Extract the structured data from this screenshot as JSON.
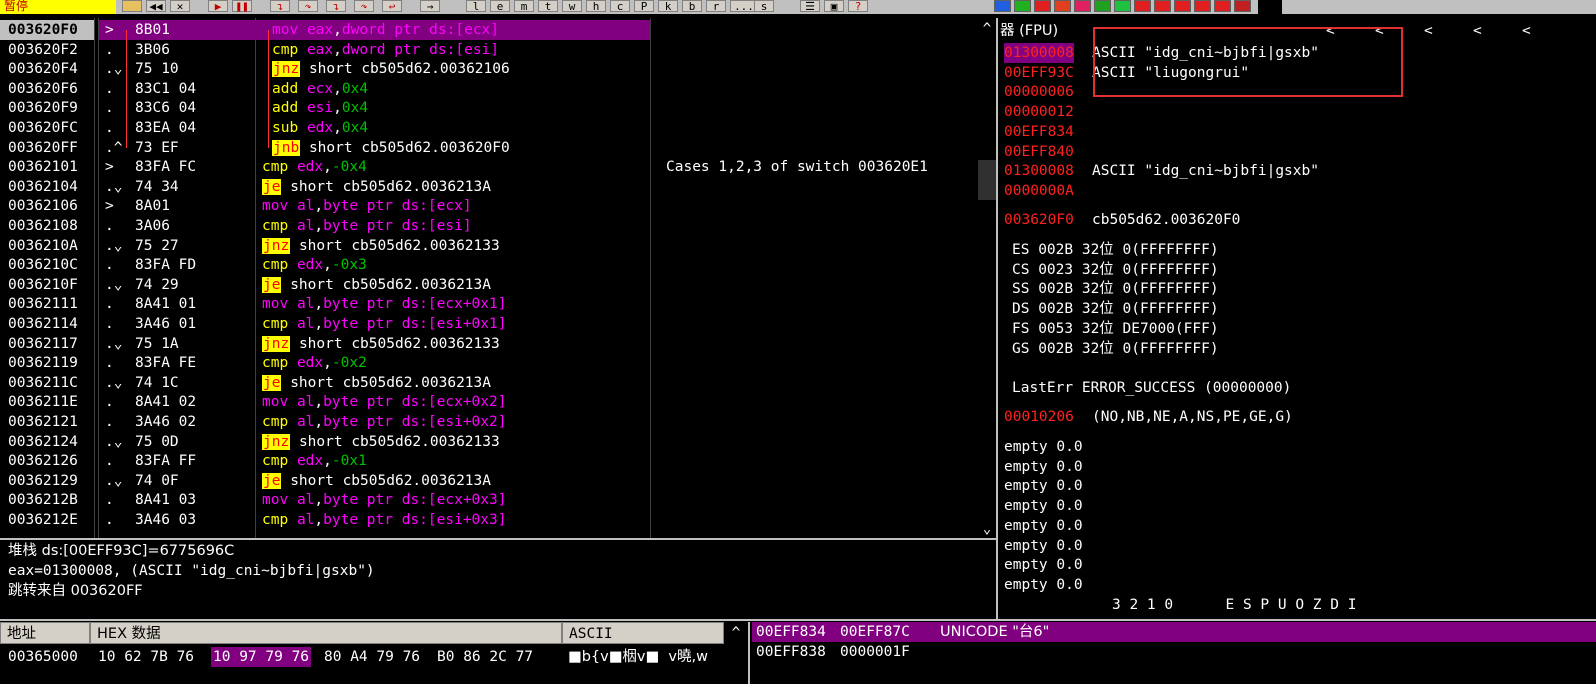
{
  "toolbar": {
    "status_label": "暂停",
    "letter_buttons": [
      "l",
      "e",
      "m",
      "t",
      "w",
      "h",
      "c",
      "P",
      "k",
      "b",
      "r",
      "...",
      "s"
    ],
    "colors": {
      "bg": "#c0c0c0",
      "status_bg": "#ffff00",
      "status_fg": "#c00000"
    }
  },
  "disasm": {
    "rows": [
      {
        "addr": "003620F0",
        "mark": ">",
        "hex": "8B01",
        "op": "mov",
        "args": [
          [
            "eax",
            "r"
          ],
          [
            ",",
            "p"
          ],
          [
            "dword ptr ds:[ecx]",
            "m"
          ]
        ],
        "selected": true,
        "comment": ""
      },
      {
        "addr": "003620F2",
        "mark": ".",
        "hex": "3B06",
        "op": "cmp",
        "args": [
          [
            "eax",
            "r"
          ],
          [
            ",",
            "p"
          ],
          [
            "dword ptr ds:[esi]",
            "m"
          ]
        ],
        "comment": ""
      },
      {
        "addr": "003620F4",
        "mark": ".⌄",
        "hex": "75 10",
        "op": "jnz",
        "args": [
          [
            "short cb505d62.00362106",
            "p"
          ]
        ],
        "comment": ""
      },
      {
        "addr": "003620F6",
        "mark": ".",
        "hex": "83C1 04",
        "op": "add",
        "args": [
          [
            "ecx",
            "r"
          ],
          [
            ",",
            "p"
          ],
          [
            "0x4",
            "n"
          ]
        ],
        "comment": ""
      },
      {
        "addr": "003620F9",
        "mark": ".",
        "hex": "83C6 04",
        "op": "add",
        "args": [
          [
            "esi",
            "r"
          ],
          [
            ",",
            "p"
          ],
          [
            "0x4",
            "n"
          ]
        ],
        "comment": ""
      },
      {
        "addr": "003620FC",
        "mark": ".",
        "hex": "83EA 04",
        "op": "sub",
        "args": [
          [
            "edx",
            "r"
          ],
          [
            ",",
            "p"
          ],
          [
            "0x4",
            "n"
          ]
        ],
        "comment": ""
      },
      {
        "addr": "003620FF",
        "mark": ".^",
        "hex": "73 EF",
        "op": "jnb",
        "args": [
          [
            "short cb505d62.003620F0",
            "p"
          ]
        ],
        "comment": ""
      },
      {
        "addr": "00362101",
        "mark": ">",
        "hex": "83FA FC",
        "op": "cmp",
        "args": [
          [
            "edx",
            "r"
          ],
          [
            ",",
            "p"
          ],
          [
            "-0x4",
            "n"
          ]
        ],
        "comment": "Cases 1,2,3 of switch 003620E1"
      },
      {
        "addr": "00362104",
        "mark": ".⌄",
        "hex": "74 34",
        "op": "je",
        "args": [
          [
            "short cb505d62.0036213A",
            "p"
          ]
        ],
        "comment": ""
      },
      {
        "addr": "00362106",
        "mark": ">",
        "hex": "8A01",
        "op": "mov",
        "args": [
          [
            "al",
            "r"
          ],
          [
            ",",
            "p"
          ],
          [
            "byte ptr ds:[ecx]",
            "m"
          ]
        ],
        "comment": ""
      },
      {
        "addr": "00362108",
        "mark": ".",
        "hex": "3A06",
        "op": "cmp",
        "args": [
          [
            "al",
            "r"
          ],
          [
            ",",
            "p"
          ],
          [
            "byte ptr ds:[esi]",
            "m"
          ]
        ],
        "comment": ""
      },
      {
        "addr": "0036210A",
        "mark": ".⌄",
        "hex": "75 27",
        "op": "jnz",
        "args": [
          [
            "short cb505d62.00362133",
            "p"
          ]
        ],
        "comment": ""
      },
      {
        "addr": "0036210C",
        "mark": ".",
        "hex": "83FA FD",
        "op": "cmp",
        "args": [
          [
            "edx",
            "r"
          ],
          [
            ",",
            "p"
          ],
          [
            "-0x3",
            "n"
          ]
        ],
        "comment": ""
      },
      {
        "addr": "0036210F",
        "mark": ".⌄",
        "hex": "74 29",
        "op": "je",
        "args": [
          [
            "short cb505d62.0036213A",
            "p"
          ]
        ],
        "comment": ""
      },
      {
        "addr": "00362111",
        "mark": ".",
        "hex": "8A41 01",
        "op": "mov",
        "args": [
          [
            "al",
            "r"
          ],
          [
            ",",
            "p"
          ],
          [
            "byte ptr ds:[ecx+0x1]",
            "m"
          ]
        ],
        "comment": ""
      },
      {
        "addr": "00362114",
        "mark": ".",
        "hex": "3A46 01",
        "op": "cmp",
        "args": [
          [
            "al",
            "r"
          ],
          [
            ",",
            "p"
          ],
          [
            "byte ptr ds:[esi+0x1]",
            "m"
          ]
        ],
        "comment": ""
      },
      {
        "addr": "00362117",
        "mark": ".⌄",
        "hex": "75 1A",
        "op": "jnz",
        "args": [
          [
            "short cb505d62.00362133",
            "p"
          ]
        ],
        "comment": ""
      },
      {
        "addr": "00362119",
        "mark": ".",
        "hex": "83FA FE",
        "op": "cmp",
        "args": [
          [
            "edx",
            "r"
          ],
          [
            ",",
            "p"
          ],
          [
            "-0x2",
            "n"
          ]
        ],
        "comment": ""
      },
      {
        "addr": "0036211C",
        "mark": ".⌄",
        "hex": "74 1C",
        "op": "je",
        "args": [
          [
            "short cb505d62.0036213A",
            "p"
          ]
        ],
        "comment": ""
      },
      {
        "addr": "0036211E",
        "mark": ".",
        "hex": "8A41 02",
        "op": "mov",
        "args": [
          [
            "al",
            "r"
          ],
          [
            ",",
            "p"
          ],
          [
            "byte ptr ds:[ecx+0x2]",
            "m"
          ]
        ],
        "comment": ""
      },
      {
        "addr": "00362121",
        "mark": ".",
        "hex": "3A46 02",
        "op": "cmp",
        "args": [
          [
            "al",
            "r"
          ],
          [
            ",",
            "p"
          ],
          [
            "byte ptr ds:[esi+0x2]",
            "m"
          ]
        ],
        "comment": ""
      },
      {
        "addr": "00362124",
        "mark": ".⌄",
        "hex": "75 0D",
        "op": "jnz",
        "args": [
          [
            "short cb505d62.00362133",
            "p"
          ]
        ],
        "comment": ""
      },
      {
        "addr": "00362126",
        "mark": ".",
        "hex": "83FA FF",
        "op": "cmp",
        "args": [
          [
            "edx",
            "r"
          ],
          [
            ",",
            "p"
          ],
          [
            "-0x1",
            "n"
          ]
        ],
        "comment": ""
      },
      {
        "addr": "00362129",
        "mark": ".⌄",
        "hex": "74 0F",
        "op": "je",
        "args": [
          [
            "short cb505d62.0036213A",
            "p"
          ]
        ],
        "comment": ""
      },
      {
        "addr": "0036212B",
        "mark": ".",
        "hex": "8A41 03",
        "op": "mov",
        "args": [
          [
            "al",
            "r"
          ],
          [
            ",",
            "p"
          ],
          [
            "byte ptr ds:[ecx+0x3]",
            "m"
          ]
        ],
        "comment": ""
      },
      {
        "addr": "0036212E",
        "mark": ".",
        "hex": "3A46 03",
        "op": "cmp",
        "args": [
          [
            "al",
            "r"
          ],
          [
            ",",
            "p"
          ],
          [
            "byte ptr ds:[esi+0x3]",
            "m"
          ]
        ],
        "comment": ""
      }
    ]
  },
  "info": {
    "line1": "堆栈 ds:[00EFF93C]=6775696C",
    "line2": "eax=01300008, (ASCII \"idg_cni~bjbfi|gsxb\")",
    "line3": "跳转来自 003620FF"
  },
  "registers": {
    "title": "器 (FPU)",
    "arrows": [
      "<",
      "<",
      "<",
      "<",
      "<"
    ],
    "gp": [
      {
        "val": "01300008",
        "text": "ASCII \"idg_cni~bjbfi|gsxb\"",
        "hl": true
      },
      {
        "val": "00EFF93C",
        "text": "ASCII \"liugongrui\""
      },
      {
        "val": "00000006",
        "text": ""
      },
      {
        "val": "00000012",
        "text": ""
      },
      {
        "val": "00EFF834",
        "text": ""
      },
      {
        "val": "00EFF840",
        "text": ""
      },
      {
        "val": "01300008",
        "text": "ASCII \"idg_cni~bjbfi|gsxb\""
      },
      {
        "val": "0000000A",
        "text": ""
      }
    ],
    "eip": {
      "val": "003620F0",
      "text": "cb505d62.003620F0"
    },
    "segments": [
      "ES 002B 32位 0(FFFFFFFF)",
      "CS 0023 32位 0(FFFFFFFF)",
      "SS 002B 32位 0(FFFFFFFF)",
      "DS 002B 32位 0(FFFFFFFF)",
      "FS 0053 32位 DE7000(FFF)",
      "GS 002B 32位 0(FFFFFFFF)"
    ],
    "lasterr": "LastErr ERROR_SUCCESS (00000000)",
    "eflags": {
      "val": "00010206",
      "text": "(NO,NB,NE,A,NS,PE,GE,G)"
    },
    "fpu": [
      "empty 0.0",
      "empty 0.0",
      "empty 0.0",
      "empty 0.0",
      "empty 0.0",
      "empty 0.0",
      "empty 0.0",
      "empty 0.0"
    ],
    "fpu_footer": "3 2 1 0      E S P U O Z D I"
  },
  "dump": {
    "hdr_addr": "地址",
    "hdr_hex": "HEX 数据",
    "hdr_ascii": "ASCII",
    "row_addr": "00365000",
    "row_hex": [
      "10 62 7B 76",
      "10 97 79 76",
      "80 A4 79 76",
      "B0 86 2C 77"
    ],
    "row_ascii": "■b{v■栶v■  v曉,w"
  },
  "stack": {
    "rows": [
      {
        "addr": "00EFF834",
        "val": "00EFF87C",
        "text": "UNICODE \"台6\""
      },
      {
        "addr": "00EFF838",
        "val": "0000001F",
        "text": ""
      }
    ]
  }
}
